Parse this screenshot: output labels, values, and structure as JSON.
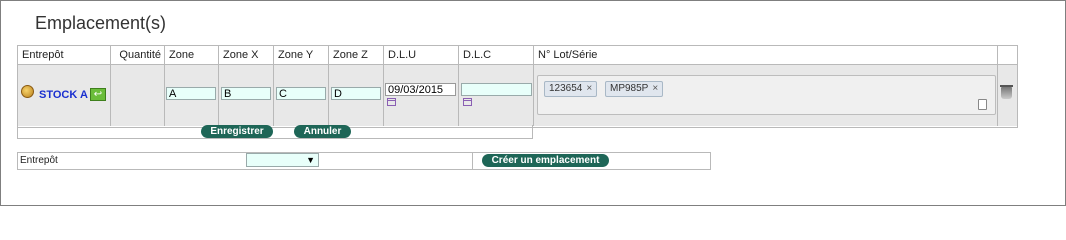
{
  "page": {
    "title": "Emplacement(s)"
  },
  "table": {
    "headers": [
      "Entrepôt",
      "Quantité",
      "Zone",
      "Zone X",
      "Zone Y",
      "Zone Z",
      "D.L.U",
      "D.L.C",
      "N° Lot/Série"
    ],
    "row": {
      "entrepot": "STOCK A",
      "quantite": "",
      "zone": "A",
      "zone_x": "B",
      "zone_y": "C",
      "zone_z": "D",
      "dlu": "09/03/2015",
      "dlc": "",
      "lots": [
        {
          "label": "123654",
          "remove": "×"
        },
        {
          "label": "MP985P",
          "remove": "×"
        }
      ]
    }
  },
  "actions": {
    "save_label": "Enregistrer",
    "cancel_label": "Annuler"
  },
  "bottom": {
    "label": "Entrepôt",
    "select_value": "",
    "select_arrow": "▼",
    "create_label": "Créer un emplacement"
  },
  "icons": {
    "enter": "↩",
    "colors": {
      "accent": "#1e6657",
      "input_bg": "#e8fffa",
      "link": "#1a2fd0"
    }
  }
}
